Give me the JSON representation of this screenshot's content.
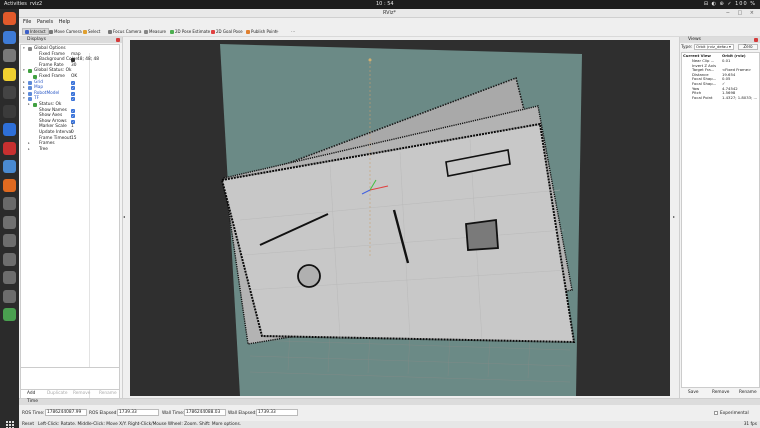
{
  "topbar": {
    "activities": "Activities",
    "app_name": "rviz2",
    "clock": "10 : 54",
    "tray": "⊟ ◐ ⊕ ✓ 100 %"
  },
  "window": {
    "title": "RViz*",
    "controls": "− □ ×"
  },
  "menubar": {
    "file": "File",
    "panels": "Panels",
    "help": "Help"
  },
  "toolbar": [
    {
      "label": "Interact",
      "active": true,
      "color": "#3b5fc8"
    },
    {
      "label": "Move Camera",
      "active": false,
      "color": "#777777"
    },
    {
      "label": "Select",
      "active": false,
      "color": "#e0a030"
    },
    {
      "label": "Focus Camera",
      "active": false,
      "color": "#777777"
    },
    {
      "label": "Measure",
      "active": false,
      "color": "#888888"
    },
    {
      "label": "2D Pose Estimate",
      "active": false,
      "color": "#4caf50"
    },
    {
      "label": "2D Goal Pose",
      "active": false,
      "color": "#e04040"
    },
    {
      "label": "Publish Point",
      "active": false,
      "color": "#e08030"
    }
  ],
  "displays": {
    "title": "Displays",
    "rows": [
      {
        "key": "Global Options",
        "value": "",
        "indent": 1,
        "tag": "▾",
        "icon": "#888888",
        "kind": "plain"
      },
      {
        "key": "Fixed Frame",
        "value": "map",
        "indent": 2,
        "tag": "",
        "icon": "",
        "kind": "plain"
      },
      {
        "key": "Background Color",
        "value": "48; 48; 48",
        "indent": 2,
        "tag": "",
        "icon": "",
        "kind": "swatch"
      },
      {
        "key": "Frame Rate",
        "value": "30",
        "indent": 2,
        "tag": "",
        "icon": "",
        "kind": "plain"
      },
      {
        "key": "Global Status: Ok",
        "value": "",
        "indent": 1,
        "tag": "▾",
        "icon": "#40a040",
        "kind": "plain"
      },
      {
        "key": "Fixed Frame",
        "value": "OK",
        "indent": 2,
        "tag": "",
        "icon": "#40a040",
        "kind": "plain"
      },
      {
        "key": "Grid",
        "value": "",
        "indent": 1,
        "tag": "▸",
        "icon": "#5d8ad8",
        "kind": "check",
        "blue": true
      },
      {
        "key": "Map",
        "value": "",
        "indent": 1,
        "tag": "▸",
        "icon": "#5d8ad8",
        "kind": "check",
        "blue": true
      },
      {
        "key": "RobotModel",
        "value": "",
        "indent": 1,
        "tag": "▸",
        "icon": "#5d8ad8",
        "kind": "check",
        "blue": true
      },
      {
        "key": "TF",
        "value": "",
        "indent": 1,
        "tag": "▾",
        "icon": "#5d8ad8",
        "kind": "check",
        "blue": true
      },
      {
        "key": "Status: Ok",
        "value": "",
        "indent": 2,
        "tag": "▸",
        "icon": "#40a040",
        "kind": "plain"
      },
      {
        "key": "Show Names",
        "value": "",
        "indent": 2,
        "tag": "",
        "icon": "",
        "kind": "check"
      },
      {
        "key": "Show Axes",
        "value": "",
        "indent": 2,
        "tag": "",
        "icon": "",
        "kind": "check"
      },
      {
        "key": "Show Arrows",
        "value": "",
        "indent": 2,
        "tag": "",
        "icon": "",
        "kind": "check"
      },
      {
        "key": "Marker Scale",
        "value": "1",
        "indent": 2,
        "tag": "",
        "icon": "",
        "kind": "plain"
      },
      {
        "key": "Update Interval",
        "value": "0",
        "indent": 2,
        "tag": "",
        "icon": "",
        "kind": "plain"
      },
      {
        "key": "Frame Timeout",
        "value": "15",
        "indent": 2,
        "tag": "",
        "icon": "",
        "kind": "plain"
      },
      {
        "key": "Frames",
        "value": "",
        "indent": 2,
        "tag": "▸",
        "icon": "",
        "kind": "plain"
      },
      {
        "key": "Tree",
        "value": "",
        "indent": 2,
        "tag": "▸",
        "icon": "",
        "kind": "plain"
      }
    ],
    "buttons": {
      "add": "Add",
      "duplicate": "Duplicate",
      "remove": "Remove",
      "rename": "Rename"
    }
  },
  "views": {
    "title": "Views",
    "type_label": "Type:",
    "type_value": "Orbit (rviz_defau ▾",
    "zero": "Zero",
    "header": {
      "key": "Current View",
      "value": "Orbit (rviz)"
    },
    "rows": [
      {
        "key": "Near Clip ...",
        "value": "0.01"
      },
      {
        "key": "Invert Z Axis",
        "value": ""
      },
      {
        "key": "Target Fra...",
        "value": "<Fixed Frame>"
      },
      {
        "key": "Distance",
        "value": "19.654"
      },
      {
        "key": "Focal Shap...",
        "value": "0.05"
      },
      {
        "key": "Focal Shap...",
        "value": "✓"
      },
      {
        "key": "Yaw",
        "value": "4.74542"
      },
      {
        "key": "Pitch",
        "value": "1.5698"
      },
      {
        "key": "Focal Point",
        "value": "1.4327; 1.8033; ..."
      }
    ],
    "buttons": {
      "save": "Save",
      "remove": "Remove",
      "rename": "Rename"
    }
  },
  "time": {
    "title": "Time",
    "ros_time_label": "ROS Time:",
    "ros_time": "1786244087.99",
    "ros_elapsed_label": "ROS Elapsed:",
    "ros_elapsed": "1739.33",
    "wall_time_label": "Wall Time:",
    "wall_time": "1786244088.03",
    "wall_elapsed_label": "Wall Elapsed:",
    "wall_elapsed": "1739.33",
    "experimental": "Experimental"
  },
  "status": {
    "reset": "Reset",
    "message": "Left-Click: Rotate. Middle-Click: Move X/Y. Right-Click/Mouse Wheel: Zoom. Shift: More options.",
    "fps": "31 fps"
  },
  "dock_icons": [
    "#e25a2b",
    "#3e7bd6",
    "#7a7a7a",
    "#f0d030",
    "#444444",
    "#3b3b3b",
    "#2e6fd8",
    "#c83030",
    "#4a8ad0",
    "#e06a20",
    "#6a6a6a",
    "#707070",
    "#6d6d6d",
    "#6d6d6d",
    "#6d6d6d",
    "#6d6d6d",
    "#4aa050"
  ]
}
